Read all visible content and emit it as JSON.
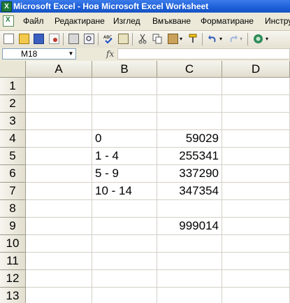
{
  "window": {
    "title": "Microsoft Excel - Нов Microsoft Excel Worksheet"
  },
  "menu": [
    "Файл",
    "Редактиране",
    "Изглед",
    "Вмъкване",
    "Форматиране",
    "Инстру"
  ],
  "toolbar": {
    "icons": [
      "new-icon",
      "open-icon",
      "save-icon",
      "permission-icon",
      "print-icon",
      "print-preview-icon",
      "spelling-icon",
      "research-icon",
      "cut-icon",
      "copy-icon",
      "paste-icon",
      "format-painter-icon",
      "undo-icon",
      "redo-icon",
      "help-icon"
    ]
  },
  "formula_bar": {
    "name_box": "M18",
    "fx": "fx",
    "formula": ""
  },
  "sheet": {
    "columns": [
      "A",
      "B",
      "C",
      "D"
    ],
    "rows": [
      {
        "n": "1",
        "a": "",
        "b": "",
        "c": "",
        "d": ""
      },
      {
        "n": "2",
        "a": "",
        "b": "",
        "c": "",
        "d": ""
      },
      {
        "n": "3",
        "a": "",
        "b": "",
        "c": "",
        "d": ""
      },
      {
        "n": "4",
        "a": "",
        "b": "0",
        "c": "59029",
        "d": ""
      },
      {
        "n": "5",
        "a": "",
        "b": "1 - 4",
        "c": "255341",
        "d": ""
      },
      {
        "n": "6",
        "a": "",
        "b": "5 - 9",
        "c": "337290",
        "d": ""
      },
      {
        "n": "7",
        "a": "",
        "b": "10 - 14",
        "c": "347354",
        "d": ""
      },
      {
        "n": "8",
        "a": "",
        "b": "",
        "c": "",
        "d": ""
      },
      {
        "n": "9",
        "a": "",
        "b": "",
        "c": "999014",
        "d": ""
      },
      {
        "n": "10",
        "a": "",
        "b": "",
        "c": "",
        "d": ""
      },
      {
        "n": "11",
        "a": "",
        "b": "",
        "c": "",
        "d": ""
      },
      {
        "n": "12",
        "a": "",
        "b": "",
        "c": "",
        "d": ""
      },
      {
        "n": "13",
        "a": "",
        "b": "",
        "c": "",
        "d": ""
      }
    ]
  }
}
